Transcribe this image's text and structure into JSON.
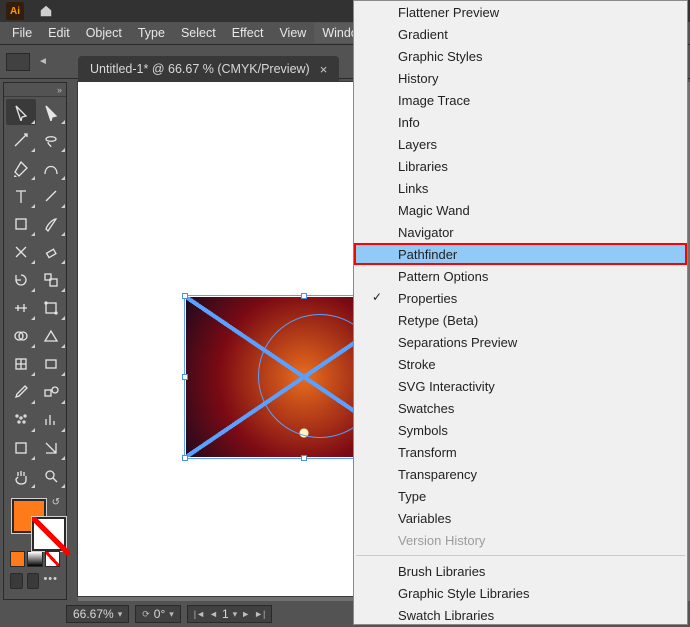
{
  "app": {
    "badge": "Ai"
  },
  "menu": {
    "items": [
      "File",
      "Edit",
      "Object",
      "Type",
      "Select",
      "Effect",
      "View",
      "Window"
    ],
    "open_index": 7
  },
  "tab": {
    "title": "Untitled-1* @ 66.67 % (CMYK/Preview)",
    "close": "×"
  },
  "status": {
    "zoom": "66.67%",
    "rotate": "0°",
    "artboard": "1"
  },
  "dropdown": {
    "items": [
      {
        "label": "Flattener Preview"
      },
      {
        "label": "Gradient"
      },
      {
        "label": "Graphic Styles"
      },
      {
        "label": "History"
      },
      {
        "label": "Image Trace"
      },
      {
        "label": "Info"
      },
      {
        "label": "Layers"
      },
      {
        "label": "Libraries"
      },
      {
        "label": "Links"
      },
      {
        "label": "Magic Wand"
      },
      {
        "label": "Navigator"
      },
      {
        "label": "Pathfinder",
        "highlight": true
      },
      {
        "label": "Pattern Options"
      },
      {
        "label": "Properties",
        "checked": true
      },
      {
        "label": "Retype (Beta)"
      },
      {
        "label": "Separations Preview"
      },
      {
        "label": "Stroke"
      },
      {
        "label": "SVG Interactivity"
      },
      {
        "label": "Swatches"
      },
      {
        "label": "Symbols"
      },
      {
        "label": "Transform"
      },
      {
        "label": "Transparency"
      },
      {
        "label": "Type"
      },
      {
        "label": "Variables"
      },
      {
        "label": "Version History",
        "disabled": true
      }
    ],
    "footer": [
      {
        "label": "Brush Libraries"
      },
      {
        "label": "Graphic Style Libraries"
      },
      {
        "label": "Swatch Libraries"
      }
    ]
  },
  "colors": {
    "fill": "#ff7a19"
  }
}
